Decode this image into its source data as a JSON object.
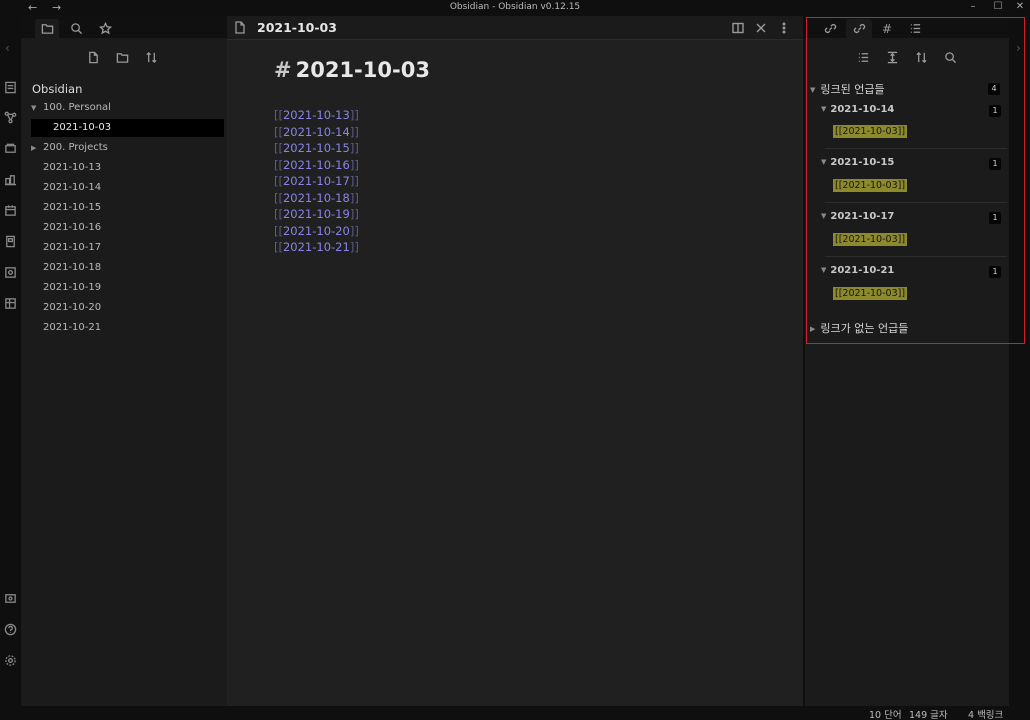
{
  "window": {
    "title": "Obsidian - Obsidian v0.12.15",
    "back": "←",
    "forward": "→",
    "minimize": "–",
    "maximize": "☐",
    "close": "✕"
  },
  "left_panel": {
    "vault_name": "Obsidian",
    "tree": [
      {
        "label": "100. Personal",
        "type": "folder",
        "expanded": true,
        "arrow": "▼"
      },
      {
        "label": "2021-10-03",
        "type": "file",
        "active": true
      },
      {
        "label": "200. Projects",
        "type": "folder",
        "expanded": false,
        "arrow": "▶"
      },
      {
        "label": "2021-10-13",
        "type": "file"
      },
      {
        "label": "2021-10-14",
        "type": "file"
      },
      {
        "label": "2021-10-15",
        "type": "file"
      },
      {
        "label": "2021-10-16",
        "type": "file"
      },
      {
        "label": "2021-10-17",
        "type": "file"
      },
      {
        "label": "2021-10-18",
        "type": "file"
      },
      {
        "label": "2021-10-19",
        "type": "file"
      },
      {
        "label": "2021-10-20",
        "type": "file"
      },
      {
        "label": "2021-10-21",
        "type": "file"
      }
    ]
  },
  "editor": {
    "tab_title": "2021-10-03",
    "heading_hash": "#",
    "heading": "2021-10-03",
    "bracket_open": "[[",
    "bracket_close": "]]",
    "links": [
      "2021-10-13",
      "2021-10-14",
      "2021-10-15",
      "2021-10-16",
      "2021-10-17",
      "2021-10-18",
      "2021-10-19",
      "2021-10-20",
      "2021-10-21"
    ]
  },
  "backlinks": {
    "linked_title": "링크된 언급들",
    "linked_count": "4",
    "groups": [
      {
        "file": "2021-10-14",
        "count": "1",
        "ref": "[[2021-10-03]]"
      },
      {
        "file": "2021-10-15",
        "count": "1",
        "ref": "[[2021-10-03]]"
      },
      {
        "file": "2021-10-17",
        "count": "1",
        "ref": "[[2021-10-03]]"
      },
      {
        "file": "2021-10-21",
        "count": "1",
        "ref": "[[2021-10-03]]"
      }
    ],
    "unlinked_title": "링크가 없는 언급들",
    "arrow_open": "▼",
    "arrow_closed": "▶"
  },
  "status": {
    "words": "10 단어",
    "chars": "149 글자",
    "backlinks": "4 백링크"
  },
  "colors": {
    "accent_link": "#8a84e6",
    "highlight_ref": "#8d8a2c",
    "annotation_box": "#d0202a"
  }
}
